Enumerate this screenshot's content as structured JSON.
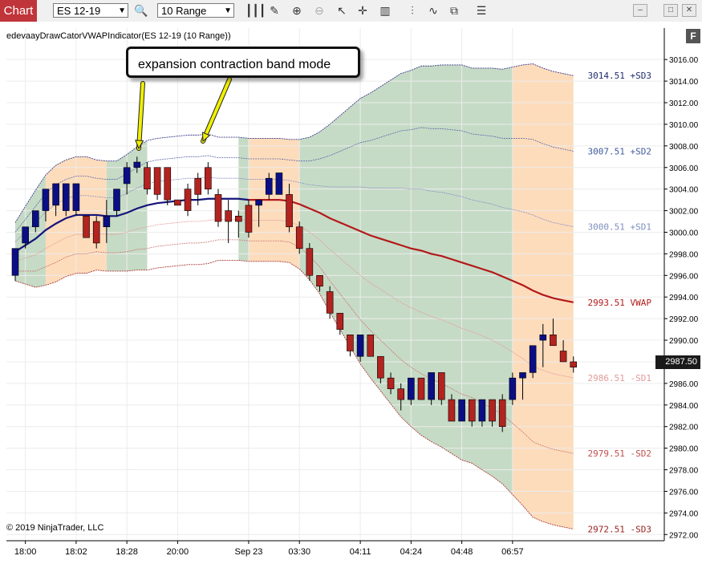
{
  "toolbar": {
    "tab_label": "Chart",
    "instrument": "ES 12-19",
    "bar_type": "10 Range",
    "icons": [
      "search-icon",
      "bar-style-icon",
      "draw-tool-icon",
      "zoom-in-icon",
      "zoom-out-icon",
      "pointer-icon",
      "crosshair-icon",
      "strategy-icon",
      "indicator-icon",
      "properties-icon"
    ],
    "window_buttons": [
      "minimize-icon",
      "maximize-icon",
      "close-icon"
    ]
  },
  "chart_title": "edevaayDrawCatorVWAPIndicator(ES 12-19 (10 Range))",
  "copyright": "© 2019 NinjaTrader, LLC",
  "annotation": "expansion contraction band mode",
  "last_price_label": "2987.50",
  "panel_button": "F",
  "colors": {
    "up_candle": "#0a0f85",
    "down_candle": "#b3231f",
    "vwap": "#b31a1a",
    "expansion_fill": "#c6dbc6",
    "contraction_fill": "#fddcbc",
    "upper_band": "#3a3a8a",
    "lower_band": "#c0504d",
    "arrow": "#f0f000"
  },
  "chart_data": {
    "type": "candlestick",
    "title": "edevaayDrawCatorVWAPIndicator(ES 12-19 (10 Range))",
    "y_axis": {
      "min": 2971.5,
      "max": 3017.5,
      "ticks": [
        3016,
        3014,
        3012,
        3010,
        3008,
        3006,
        3004,
        3002,
        3000,
        2998,
        2996,
        2994,
        2992,
        2990,
        2988,
        2986,
        2984,
        2982,
        2980,
        2978,
        2976,
        2974,
        2972
      ],
      "tick_labels": [
        "3016.00",
        "3014.00",
        "3012.00",
        "3010.00",
        "3008.00",
        "3006.00",
        "3004.00",
        "3002.00",
        "3000.00",
        "2998.00",
        "2996.00",
        "2994.00",
        "2992.00",
        "2990.00",
        "2988.00",
        "2986.00",
        "2984.00",
        "2982.00",
        "2980.00",
        "2978.00",
        "2976.00",
        "2974.00",
        "2972.00"
      ]
    },
    "x_axis": {
      "tick_labels": [
        "18:00",
        "18:02",
        "18:28",
        "20:00",
        "Sep 23",
        "03:30",
        "04:11",
        "04:24",
        "04:48",
        "06:57"
      ],
      "tick_bar_index": [
        1,
        6,
        11,
        16,
        23,
        28,
        34,
        39,
        44,
        49
      ]
    },
    "candles": [
      {
        "o": 2996,
        "h": 2998.5,
        "l": 2995.5,
        "c": 2998.5
      },
      {
        "o": 2999,
        "h": 3000.5,
        "l": 2998.5,
        "c": 3000.5
      },
      {
        "o": 3000.5,
        "h": 3002,
        "l": 3000,
        "c": 3002
      },
      {
        "o": 3002,
        "h": 3004,
        "l": 3001,
        "c": 3004
      },
      {
        "o": 3002.5,
        "h": 3004.5,
        "l": 3001.5,
        "c": 3004.5
      },
      {
        "o": 3002,
        "h": 3004.5,
        "l": 3001.5,
        "c": 3004.5
      },
      {
        "o": 3002,
        "h": 3004.5,
        "l": 3001.5,
        "c": 3004.5
      },
      {
        "o": 3001.5,
        "h": 3001.5,
        "l": 2999.5,
        "c": 2999.5
      },
      {
        "o": 3001,
        "h": 3001.5,
        "l": 2998.5,
        "c": 2999
      },
      {
        "o": 3000.5,
        "h": 3003,
        "l": 2999,
        "c": 3001.5
      },
      {
        "o": 3002,
        "h": 3004,
        "l": 3001.5,
        "c": 3004
      },
      {
        "o": 3004.5,
        "h": 3006.5,
        "l": 3003.5,
        "c": 3006
      },
      {
        "o": 3006,
        "h": 3007,
        "l": 3005.5,
        "c": 3006.5
      },
      {
        "o": 3006,
        "h": 3006.5,
        "l": 3003.5,
        "c": 3004
      },
      {
        "o": 3006,
        "h": 3006,
        "l": 3003,
        "c": 3003.5
      },
      {
        "o": 3006,
        "h": 3006,
        "l": 3002.5,
        "c": 3003
      },
      {
        "o": 3003,
        "h": 3003,
        "l": 3002.5,
        "c": 3002.5
      },
      {
        "o": 3004,
        "h": 3004.5,
        "l": 3001.5,
        "c": 3002
      },
      {
        "o": 3005,
        "h": 3005.5,
        "l": 3002.5,
        "c": 3003.5
      },
      {
        "o": 3006,
        "h": 3006.5,
        "l": 3003.5,
        "c": 3004
      },
      {
        "o": 3003.5,
        "h": 3004,
        "l": 3000.5,
        "c": 3001
      },
      {
        "o": 3002,
        "h": 3003,
        "l": 2999,
        "c": 3001
      },
      {
        "o": 3001.5,
        "h": 3002,
        "l": 2999.5,
        "c": 3001
      },
      {
        "o": 3002.5,
        "h": 3003,
        "l": 2999.5,
        "c": 3000
      },
      {
        "o": 3002.5,
        "h": 3003,
        "l": 3000.5,
        "c": 3003
      },
      {
        "o": 3003.5,
        "h": 3005.5,
        "l": 3003,
        "c": 3005
      },
      {
        "o": 3003.5,
        "h": 3005.5,
        "l": 3003.5,
        "c": 3005.5
      },
      {
        "o": 3003.5,
        "h": 3004.5,
        "l": 3000,
        "c": 3000.5
      },
      {
        "o": 3000.5,
        "h": 3001,
        "l": 2998,
        "c": 2998.5
      },
      {
        "o": 2998.5,
        "h": 2999,
        "l": 2995.5,
        "c": 2996
      },
      {
        "o": 2996,
        "h": 2996,
        "l": 2994.5,
        "c": 2995
      },
      {
        "o": 2994.5,
        "h": 2995,
        "l": 2992,
        "c": 2992.5
      },
      {
        "o": 2992.5,
        "h": 2992.5,
        "l": 2990.5,
        "c": 2991
      },
      {
        "o": 2990.5,
        "h": 2990.5,
        "l": 2988.5,
        "c": 2989
      },
      {
        "o": 2988.5,
        "h": 2990.5,
        "l": 2988,
        "c": 2990.5
      },
      {
        "o": 2990.5,
        "h": 2990.5,
        "l": 2988.5,
        "c": 2988.5
      },
      {
        "o": 2988.5,
        "h": 2988.5,
        "l": 2986,
        "c": 2986.5
      },
      {
        "o": 2986.5,
        "h": 2987,
        "l": 2985,
        "c": 2985.5
      },
      {
        "o": 2985.5,
        "h": 2986,
        "l": 2983.5,
        "c": 2984.5
      },
      {
        "o": 2984.5,
        "h": 2986.5,
        "l": 2984,
        "c": 2986.5
      },
      {
        "o": 2986.5,
        "h": 2986.5,
        "l": 2984.5,
        "c": 2984.5
      },
      {
        "o": 2984.5,
        "h": 2987,
        "l": 2984,
        "c": 2987
      },
      {
        "o": 2987,
        "h": 2987,
        "l": 2984,
        "c": 2984.5
      },
      {
        "o": 2984.5,
        "h": 2985,
        "l": 2982.5,
        "c": 2982.5
      },
      {
        "o": 2982.5,
        "h": 2984.5,
        "l": 2982.5,
        "c": 2984.5
      },
      {
        "o": 2984.5,
        "h": 2984.5,
        "l": 2982,
        "c": 2982.5
      },
      {
        "o": 2982.5,
        "h": 2984.5,
        "l": 2982,
        "c": 2984.5
      },
      {
        "o": 2984.5,
        "h": 2984.5,
        "l": 2982,
        "c": 2982.5
      },
      {
        "o": 2984.5,
        "h": 2985,
        "l": 2981.5,
        "c": 2982
      },
      {
        "o": 2984.5,
        "h": 2987,
        "l": 2984,
        "c": 2986.5
      },
      {
        "o": 2986.5,
        "h": 2987,
        "l": 2984.5,
        "c": 2987
      },
      {
        "o": 2987,
        "h": 2989.5,
        "l": 2986.5,
        "c": 2989.5
      },
      {
        "o": 2990,
        "h": 2991.5,
        "l": 2987.5,
        "c": 2990.5
      },
      {
        "o": 2990.5,
        "h": 2992,
        "l": 2989.5,
        "c": 2989.5
      },
      {
        "o": 2989,
        "h": 2990,
        "l": 2988,
        "c": 2988
      },
      {
        "o": 2988,
        "h": 2988.5,
        "l": 2987,
        "c": 2987.5
      }
    ],
    "vwap": [
      2998.2,
      2998.8,
      2999.4,
      3000.2,
      3000.8,
      3001.3,
      3001.6,
      3001.6,
      3001.6,
      3001.5,
      3001.5,
      3001.8,
      3002.2,
      3002.5,
      3002.7,
      3002.8,
      3002.9,
      3003.0,
      3003.0,
      3003.1,
      3003.1,
      3003.1,
      3003.1,
      3003.0,
      3003.0,
      3003.0,
      3003.0,
      3002.9,
      3002.6,
      3002.2,
      3001.8,
      3001.3,
      3000.9,
      3000.5,
      3000.1,
      2999.7,
      2999.4,
      2999.1,
      2998.8,
      2998.5,
      2998.3,
      2998.0,
      2997.8,
      2997.5,
      2997.2,
      2996.9,
      2996.6,
      2996.3,
      2995.9,
      2995.5,
      2995.1,
      2994.6,
      2994.2,
      2993.9,
      2993.7,
      2993.51
    ],
    "band_width_sd": [
      0.9,
      1.2,
      1.5,
      1.7,
      1.8,
      1.8,
      1.8,
      1.8,
      1.7,
      1.7,
      1.7,
      1.8,
      1.9,
      2.0,
      2.0,
      2.0,
      2.0,
      2.0,
      2.0,
      2.0,
      1.9,
      1.9,
      1.9,
      1.9,
      1.9,
      1.9,
      1.9,
      1.9,
      2.0,
      2.2,
      2.5,
      2.9,
      3.3,
      3.7,
      4.1,
      4.4,
      4.7,
      5.0,
      5.3,
      5.5,
      5.7,
      5.8,
      5.9,
      6.0,
      6.1,
      6.1,
      6.2,
      6.3,
      6.4,
      6.6,
      6.8,
      7.0,
      7.0,
      7.0,
      7.0,
      7.0
    ],
    "regions": [
      {
        "mode": "expansion",
        "from": 0,
        "to": 3
      },
      {
        "mode": "contraction",
        "from": 3,
        "to": 9
      },
      {
        "mode": "expansion",
        "from": 9,
        "to": 13
      },
      {
        "mode": "contraction",
        "from": 13
      },
      {
        "mode": "expansion",
        "from": 22,
        "to": 23
      },
      {
        "mode": "contraction",
        "from": 23,
        "to": 28
      },
      {
        "mode": "expansion",
        "from": 28,
        "to": 49
      },
      {
        "mode": "contraction",
        "from": 49,
        "to": 55
      }
    ],
    "level_labels": [
      {
        "value": 3014.51,
        "text": "3014.51 +SD3",
        "color": "#1f2e6b"
      },
      {
        "value": 3007.51,
        "text": "3007.51 +SD2",
        "color": "#3f5a9c"
      },
      {
        "value": 3000.51,
        "text": "3000.51 +SD1",
        "color": "#7f8fc0"
      },
      {
        "value": 2993.51,
        "text": "2993.51 VWAP",
        "color": "#b31a1a"
      },
      {
        "value": 2986.51,
        "text": "2986.51 -SD1",
        "color": "#e09a98"
      },
      {
        "value": 2979.51,
        "text": "2979.51 -SD2",
        "color": "#c0504d"
      },
      {
        "value": 2972.51,
        "text": "2972.51 -SD3",
        "color": "#9a2321"
      }
    ]
  }
}
